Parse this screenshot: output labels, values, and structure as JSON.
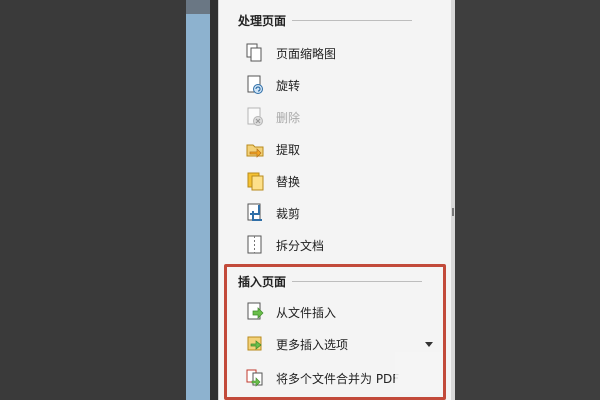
{
  "panel": {
    "sections": [
      {
        "title": "处理页面",
        "items": [
          {
            "label": "页面缩略图",
            "icon": "page-thumbnails-icon",
            "disabled": false
          },
          {
            "label": "旋转",
            "icon": "rotate-icon",
            "disabled": false
          },
          {
            "label": "删除",
            "icon": "delete-icon",
            "disabled": true
          },
          {
            "label": "提取",
            "icon": "extract-icon",
            "disabled": false
          },
          {
            "label": "替换",
            "icon": "replace-icon",
            "disabled": false
          },
          {
            "label": "裁剪",
            "icon": "crop-icon",
            "disabled": false
          },
          {
            "label": "拆分文档",
            "icon": "split-document-icon",
            "disabled": false
          }
        ]
      },
      {
        "title": "插入页面",
        "items": [
          {
            "label": "从文件插入",
            "icon": "insert-from-file-icon",
            "disabled": false
          },
          {
            "label": "更多插入选项",
            "icon": "more-insert-options-icon",
            "disabled": false
          },
          {
            "label": "将多个文件合并为 PDF",
            "icon": "combine-files-icon",
            "disabled": false
          }
        ]
      }
    ]
  },
  "colors": {
    "highlight_box": "#c24a3a",
    "panel_bg": "#f4f4f4",
    "side_blue": "#8db2cf"
  }
}
